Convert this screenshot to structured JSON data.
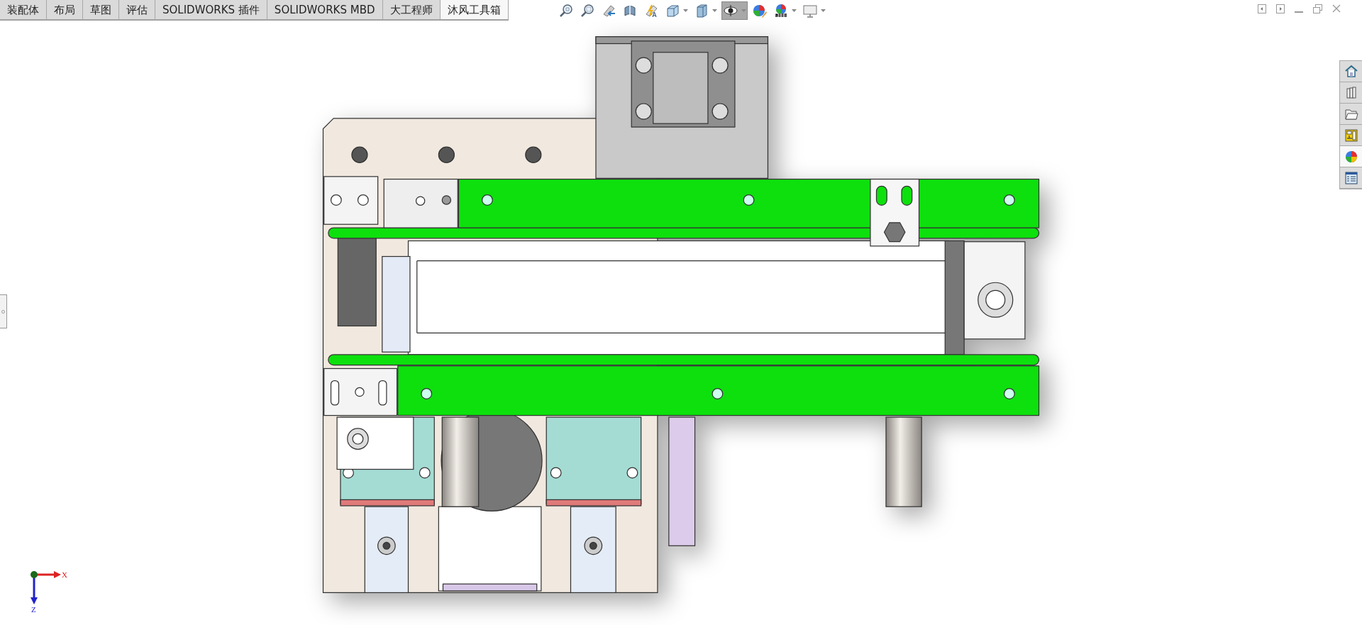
{
  "tabs": [
    {
      "label": "装配体",
      "selected": false
    },
    {
      "label": "布局",
      "selected": false
    },
    {
      "label": "草图",
      "selected": false
    },
    {
      "label": "评估",
      "selected": false
    },
    {
      "label": "SOLIDWORKS 插件",
      "selected": false
    },
    {
      "label": "SOLIDWORKS MBD",
      "selected": false
    },
    {
      "label": "大工程师",
      "selected": false
    },
    {
      "label": "沐风工具箱",
      "selected": true
    }
  ],
  "view_toolbar": [
    {
      "kind": "zoom-fit",
      "dropdown": false,
      "pressed": false
    },
    {
      "kind": "zoom-area",
      "dropdown": false,
      "pressed": false
    },
    {
      "kind": "previous-view",
      "dropdown": false,
      "pressed": false
    },
    {
      "kind": "section-view",
      "dropdown": false,
      "pressed": false
    },
    {
      "kind": "annotation",
      "dropdown": false,
      "pressed": false
    },
    {
      "kind": "orientation",
      "dropdown": true,
      "pressed": false
    },
    {
      "kind": "display-style",
      "dropdown": true,
      "pressed": false
    },
    {
      "kind": "hide-show",
      "dropdown": true,
      "pressed": true
    },
    {
      "kind": "appearance",
      "dropdown": false,
      "pressed": false
    },
    {
      "kind": "scene",
      "dropdown": true,
      "pressed": false
    },
    {
      "kind": "monitor",
      "dropdown": true,
      "pressed": false
    }
  ],
  "task_pane": [
    {
      "kind": "home",
      "selected": false
    },
    {
      "kind": "library",
      "selected": false
    },
    {
      "kind": "folder",
      "selected": false
    },
    {
      "kind": "palette",
      "selected": false
    },
    {
      "kind": "appearance",
      "selected": true
    },
    {
      "kind": "properties",
      "selected": false
    }
  ],
  "triad": {
    "x_label": "X",
    "z_label": "Z"
  }
}
